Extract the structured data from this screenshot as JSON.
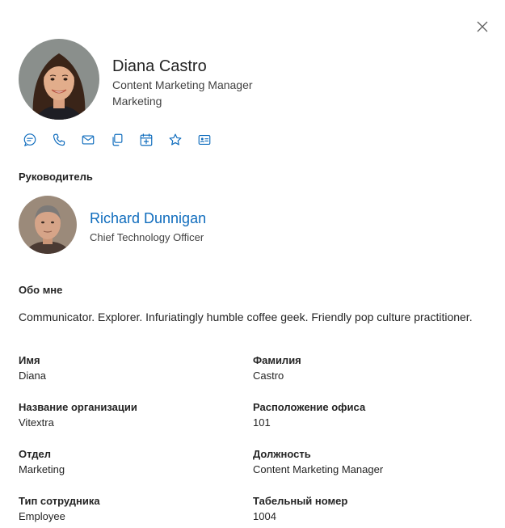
{
  "close_icon": "close-icon",
  "person": {
    "name": "Diana Castro",
    "job_title": "Content Marketing Manager",
    "department": "Marketing"
  },
  "actions": [
    {
      "icon": "chat-icon"
    },
    {
      "icon": "phone-icon"
    },
    {
      "icon": "mail-icon"
    },
    {
      "icon": "copy-icon"
    },
    {
      "icon": "calendar-icon"
    },
    {
      "icon": "star-icon"
    },
    {
      "icon": "contact-card-icon"
    }
  ],
  "manager_section": {
    "heading": "Руководитель",
    "name": "Richard Dunnigan",
    "job_title": "Chief Technology Officer"
  },
  "about_section": {
    "heading": "Обо мне",
    "text": "Communicator. Explorer. Infuriatingly humble coffee geek. Friendly pop culture practitioner."
  },
  "details": [
    {
      "label": "Имя",
      "value": "Diana"
    },
    {
      "label": "Фамилия",
      "value": "Castro"
    },
    {
      "label": "Название организации",
      "value": "Vitextra"
    },
    {
      "label": "Расположение офиса",
      "value": "101"
    },
    {
      "label": "Отдел",
      "value": "Marketing"
    },
    {
      "label": "Должность",
      "value": "Content Marketing Manager"
    },
    {
      "label": "Тип сотрудника",
      "value": "Employee"
    },
    {
      "label": "Табельный номер",
      "value": "1004"
    }
  ],
  "colors": {
    "accent": "#0f6cbd",
    "text": "#242424",
    "secondary_text": "#424242"
  }
}
